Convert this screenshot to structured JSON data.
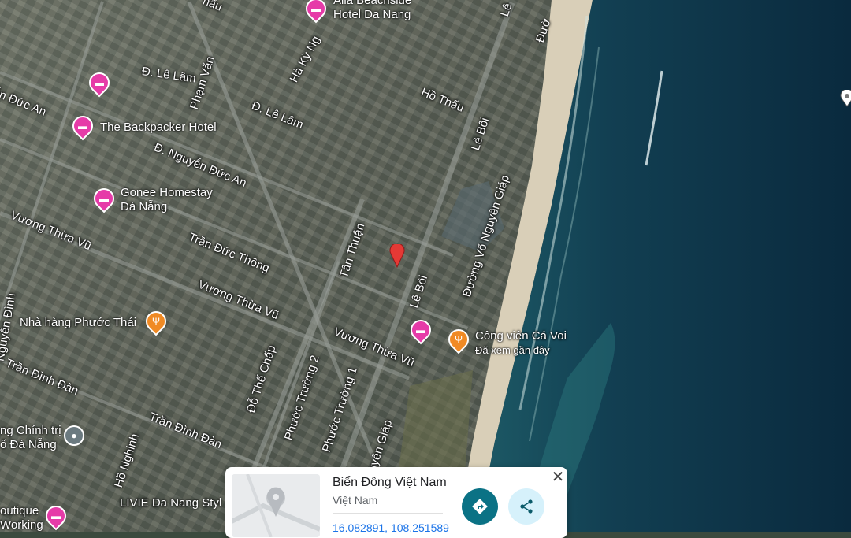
{
  "map": {
    "streets": {
      "le_lam_1": "Đ. Lê Lâm",
      "le_lam_2": "Đ. Lê Lâm",
      "pham_van": "Phạm Văn",
      "ha_ky_ng": "Hà Kỳ Ng",
      "ho_thau": "Hồ Thấu",
      "le_boi_1": "Lê Bôi",
      "le_boi_2": "Lê Bôi",
      "nguyen_duc_an_1": "Đ. Nguyễn Đức An",
      "nguyen_duc_an_2": "ễn Đức An",
      "vuong_thua_vu_1": "Vương Thừa Vũ",
      "vuong_thua_vu_2": "Vương Thừa Vũ",
      "vuong_thua_vu_3": "Vương Thừa Vũ",
      "tran_duc_thong": "Trần Đức Thông",
      "tan_thuan": "Tân Thuận",
      "vo_nguyen_giap_1": "Đường Võ Nguyên Giáp",
      "vo_nguyen_giap_2": "uyên Giáp",
      "do_the_chap": "Đỗ Thế Chấp",
      "phuoc_truong_2": "Phước Trường 2",
      "phuoc_truong_1": "Phước Trường 1",
      "tran_dinh_dan_1": "Trần Đình Đàn",
      "tran_dinh_dan_2": "Trần Đình Đàn",
      "ho_nghinh": "Hồ Nghinh",
      "nguyen_dinh": "Nguyễn Đình",
      "duong_top": "Đườ",
      "le_top": "Lê",
      "hau_top": "hấu"
    },
    "pois": {
      "alia": "Alia Beachside\nHotel Da Nang",
      "backpacker": "The Backpacker Hotel",
      "gonee": "Gonee Homestay\nĐà Nẵng",
      "nha_hang": "Nhà hàng Phước Thái",
      "cong_vien": "Công viên Cá Voi",
      "cong_vien_sub": "Đã xem gần đây",
      "chinh_tri": "ng Chính trị\nố Đà Nẵng",
      "livie": "LIVIE Da Nang Styl",
      "working": "outique\nWorking"
    },
    "icons": {
      "hotel": "bed-icon",
      "restaurant": "fork-knife-icon",
      "government": "building-icon",
      "dropped_pin": "red-marker-icon"
    },
    "colors": {
      "hotel": "#e63ba8",
      "restaurant": "#f08a24",
      "sea_deep": "#0a2a3e",
      "sea_shallow": "#1d5a66",
      "sand": "#d9cfb8",
      "marker": "#e53935"
    }
  },
  "card": {
    "title": "Biển Đông Việt Nam",
    "subtitle": "Việt Nam",
    "coords": "16.082891, 108.251589",
    "close_label": "✕"
  }
}
